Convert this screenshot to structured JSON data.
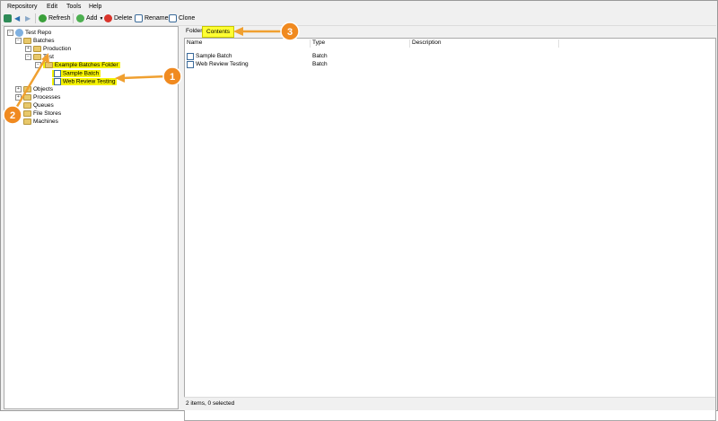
{
  "menu": [
    "Repository",
    "Edit",
    "Tools",
    "Help"
  ],
  "toolbar": {
    "refresh": "Refresh",
    "add": "Add",
    "delete": "Delete",
    "rename": "Rename",
    "clone": "Clone"
  },
  "tree": {
    "root": "Test Repo",
    "batches": "Batches",
    "production": "Production",
    "test": "Test",
    "example_folder": "Example Batches Folder",
    "sample_batch": "Sample Batch",
    "web_review": "Web Review Testing",
    "objects": "Objects",
    "processes": "Processes",
    "queues": "Queues",
    "file_stores": "File Stores",
    "machines": "Machines"
  },
  "tabs": {
    "folder": "Folder",
    "contents": "Contents"
  },
  "columns": {
    "name": "Name",
    "type": "Type",
    "description": "Description"
  },
  "rows": [
    {
      "name": "Sample Batch",
      "type": "Batch"
    },
    {
      "name": "Web Review Testing",
      "type": "Batch"
    }
  ],
  "status": "2 items, 0 selected",
  "callouts": {
    "one": "1",
    "two": "2",
    "three": "3"
  },
  "colors": {
    "highlight": "#f5f200",
    "callout": "#f0a030"
  }
}
